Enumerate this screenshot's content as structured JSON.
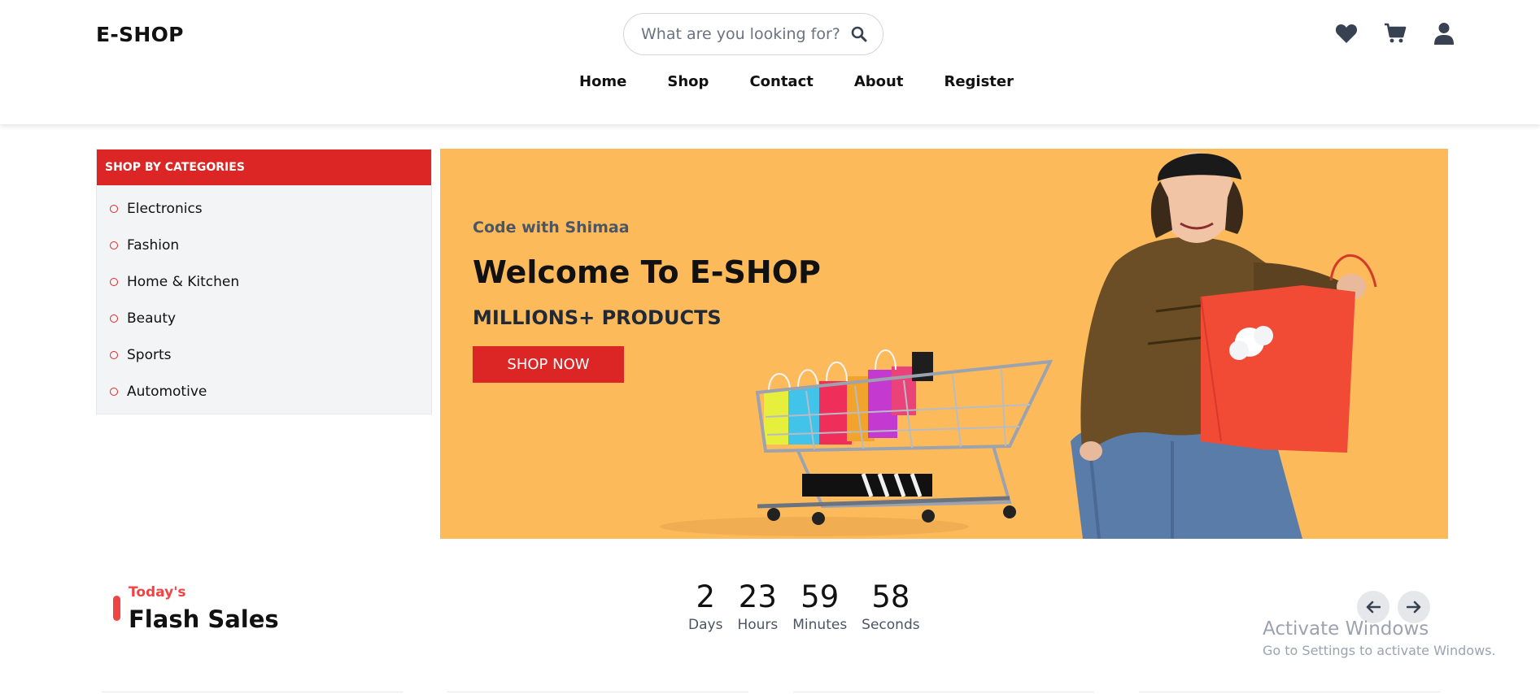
{
  "header": {
    "logo": "E-SHOP",
    "search_placeholder": "What are you looking for?",
    "icons": [
      "search-icon",
      "heart-icon",
      "cart-icon",
      "user-icon"
    ],
    "nav": [
      "Home",
      "Shop",
      "Contact",
      "About",
      "Register"
    ]
  },
  "sidebar": {
    "title": "SHOP BY CATEGORIES",
    "items": [
      "Electronics",
      "Fashion",
      "Home & Kitchen",
      "Beauty",
      "Sports",
      "Automotive"
    ]
  },
  "banner": {
    "kicker": "Code with Shimaa",
    "title": "Welcome To E-SHOP",
    "subtitle": "MILLIONS+ PRODUCTS",
    "cta": "SHOP NOW",
    "background": "#fdba5a"
  },
  "flash": {
    "today": "Today's",
    "title": "Flash Sales",
    "countdown": [
      {
        "value": "2",
        "label": "Days"
      },
      {
        "value": "23",
        "label": "Hours"
      },
      {
        "value": "59",
        "label": "Minutes"
      },
      {
        "value": "58",
        "label": "Seconds"
      }
    ]
  },
  "watermark": {
    "line1": "Activate Windows",
    "line2": "Go to Settings to activate Windows."
  },
  "colors": {
    "accent": "#dc2626",
    "text": "#111111",
    "muted": "#4b5563"
  }
}
